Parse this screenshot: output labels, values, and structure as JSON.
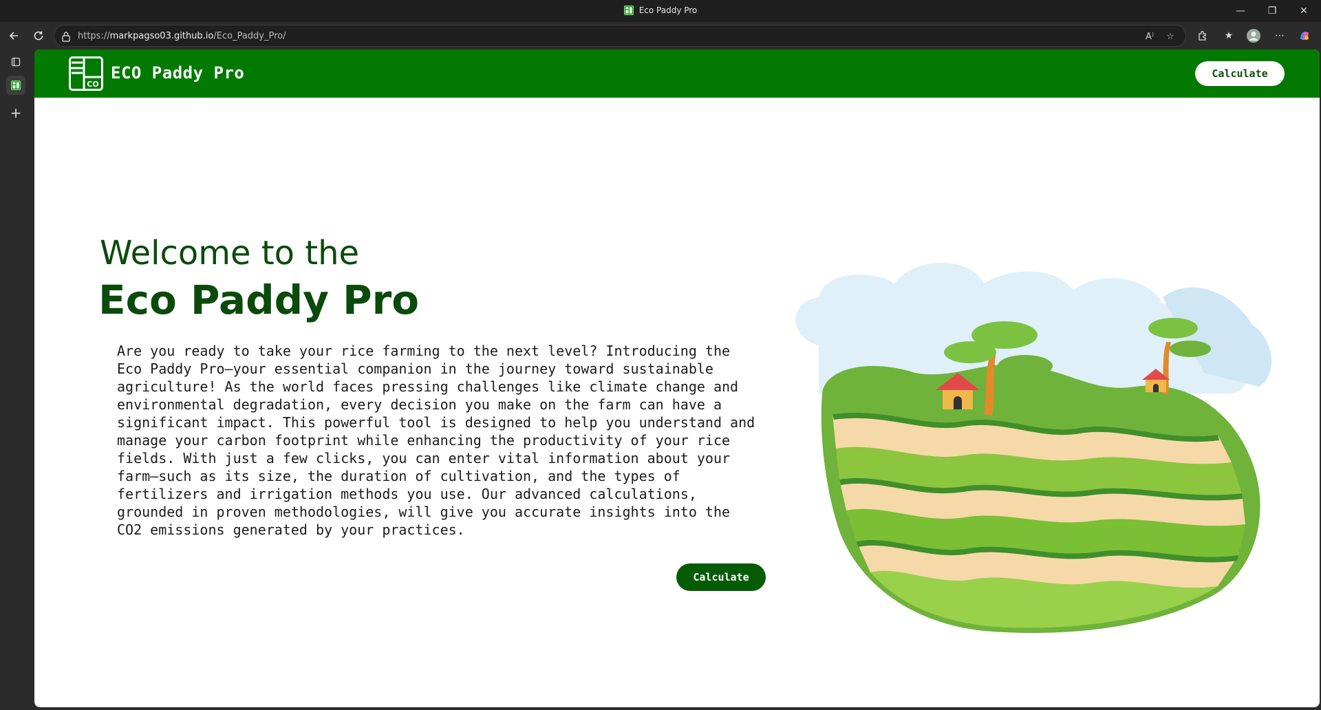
{
  "browser": {
    "window_title": "Eco Paddy Pro",
    "url_prefix": "https://",
    "url_host": "markpagso03.github.io",
    "url_path": "/Eco_Paddy_Pro/"
  },
  "site": {
    "brand": "ECO Paddy Pro",
    "logo_text": "CO",
    "header_button": "Calculate",
    "hero_pre": "Welcome to the",
    "hero_title": "Eco Paddy Pro",
    "hero_body": "Are you ready to take your rice farming to the next level? Introducing the\nEco Paddy Pro—your essential companion in the journey toward sustainable\nagriculture! As the world faces pressing challenges like climate change and\nenvironmental degradation, every decision you make on the farm can have a\nsignificant impact. This powerful tool is designed to help you understand and\nmanage your carbon footprint while enhancing the productivity of your rice\nfields. With just a few clicks, you can enter vital information about your\nfarm—such as its size, the duration of cultivation, and the types of\nfertilizers and irrigation methods you use. Our advanced calculations,\ngrounded in proven methodologies, will give you accurate insights into the\nCO2 emissions generated by your practices.",
    "cta_button": "Calculate"
  },
  "colors": {
    "header_green": "#027a02",
    "title_green": "#0a4a0a",
    "cta_green": "#055c05"
  },
  "icons": {
    "back": "back-arrow-icon",
    "refresh": "refresh-icon",
    "lock": "lock-icon",
    "read_aloud": "read-aloud-icon",
    "favorite": "star-icon",
    "extensions": "extensions-icon",
    "favorites_bar": "favorites-icon",
    "profile": "profile-avatar-icon",
    "more": "more-icon",
    "copilot": "copilot-icon",
    "minimize": "minimize-icon",
    "restore": "restore-icon",
    "close": "close-icon"
  }
}
